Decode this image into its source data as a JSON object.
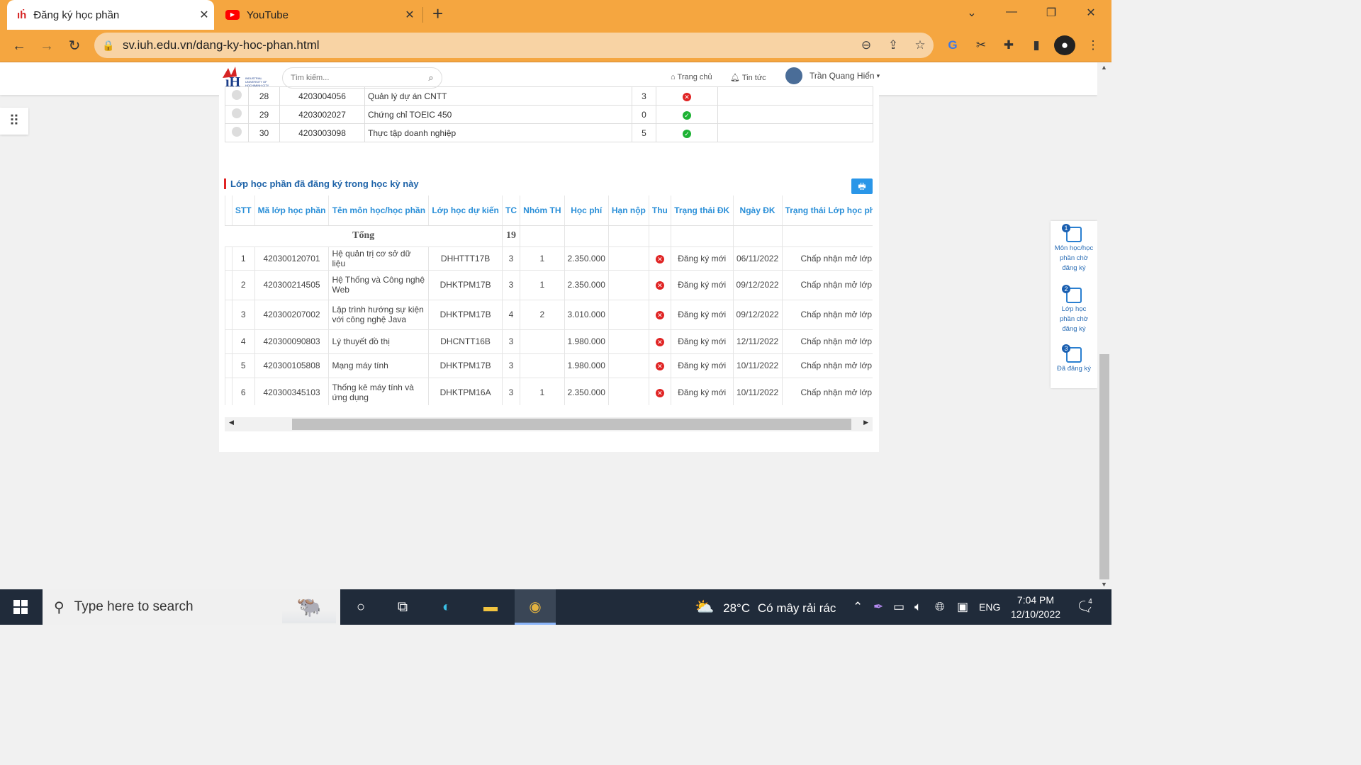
{
  "browser": {
    "tabs": [
      {
        "title": "Đăng ký học phần",
        "icon": "iuh-favicon-icon",
        "active": true
      },
      {
        "title": "YouTube",
        "icon": "youtube-icon",
        "active": false
      }
    ],
    "new_tab": "+",
    "url": "sv.iuh.edu.vn/dang-ky-hoc-phan.html"
  },
  "site": {
    "search_placeholder": "Tìm kiếm...",
    "nav": {
      "home": "Trang chủ",
      "news": "Tin tức"
    },
    "user_name": "Trần Quang Hiển"
  },
  "course_list": {
    "rows": [
      {
        "stt": "28",
        "code": "4203004056",
        "name": "Quản lý dự án CNTT",
        "credits": "3",
        "status": "fail"
      },
      {
        "stt": "29",
        "code": "4203002027",
        "name": "Chứng chỉ TOEIC 450",
        "credits": "0",
        "status": "ok"
      },
      {
        "stt": "30",
        "code": "4203003098",
        "name": "Thực tập doanh nghiệp",
        "credits": "5",
        "status": "ok"
      }
    ]
  },
  "registered": {
    "title": "Lớp học phần đã đăng ký trong học kỳ này",
    "columns": [
      "STT",
      "Mã lớp học phần",
      "Tên môn học/học phần",
      "Lớp học dự kiến",
      "TC",
      "Nhóm TH",
      "Học phí",
      "Hạn nộp",
      "Thu",
      "Trạng thái ĐK",
      "Ngày ĐK",
      "Trạng thái Lớp học phần"
    ],
    "total_label": "Tổng",
    "total_credits": "19",
    "rows": [
      {
        "stt": "1",
        "code": "420300120701",
        "name": "Hệ quản trị cơ sở dữ liệu",
        "class": "DHHTTT17B",
        "tc": "3",
        "group": "1",
        "fee": "2.350.000",
        "due": "",
        "status": "Đăng ký mới",
        "date": "06/11/2022",
        "class_status": "Chấp nhận mở lớp"
      },
      {
        "stt": "2",
        "code": "420300214505",
        "name": "Hệ Thống và Công nghệ Web",
        "class": "DHKTPM17B",
        "tc": "3",
        "group": "1",
        "fee": "2.350.000",
        "due": "",
        "status": "Đăng ký mới",
        "date": "09/12/2022",
        "class_status": "Chấp nhận mở lớp"
      },
      {
        "stt": "3",
        "code": "420300207002",
        "name": "Lập trình hướng sự kiện với công nghệ Java",
        "class": "DHKTPM17B",
        "tc": "4",
        "group": "2",
        "fee": "3.010.000",
        "due": "",
        "status": "Đăng ký mới",
        "date": "09/12/2022",
        "class_status": "Chấp nhận mở lớp"
      },
      {
        "stt": "4",
        "code": "420300090803",
        "name": "Lý thuyết đồ thị",
        "class": "DHCNTT16B",
        "tc": "3",
        "group": "",
        "fee": "1.980.000",
        "due": "",
        "status": "Đăng ký mới",
        "date": "12/11/2022",
        "class_status": "Chấp nhận mở lớp"
      },
      {
        "stt": "5",
        "code": "420300105808",
        "name": "Mạng máy tính",
        "class": "DHKTPM17B",
        "tc": "3",
        "group": "",
        "fee": "1.980.000",
        "due": "",
        "status": "Đăng ký mới",
        "date": "10/11/2022",
        "class_status": "Chấp nhận mở lớp"
      },
      {
        "stt": "6",
        "code": "420300345103",
        "name": "Thống kê máy tính và ứng dụng",
        "class": "DHKTPM16A",
        "tc": "3",
        "group": "1",
        "fee": "2.350.000",
        "due": "",
        "status": "Đăng ký mới",
        "date": "10/11/2022",
        "class_status": "Chấp nhận mở lớp"
      }
    ],
    "horizontal_scroll_fraction": 0.12
  },
  "sidebar": [
    {
      "num": "1",
      "label": "Môn học/học phần chờ đăng ký"
    },
    {
      "num": "2",
      "label": "Lớp học phần chờ đăng ký"
    },
    {
      "num": "3",
      "label": "Đã đăng ký"
    }
  ],
  "taskbar": {
    "search_text": "Type here to search",
    "weather_temp": "28°C",
    "weather_text": "Có mây rải rác",
    "lang": "ENG",
    "time": "7:04 PM",
    "date": "12/10/2022",
    "notifications": "4"
  },
  "colors": {
    "accent": "#f5a640",
    "link": "#2a8fd8",
    "error": "#e02424",
    "success": "#1db234"
  }
}
